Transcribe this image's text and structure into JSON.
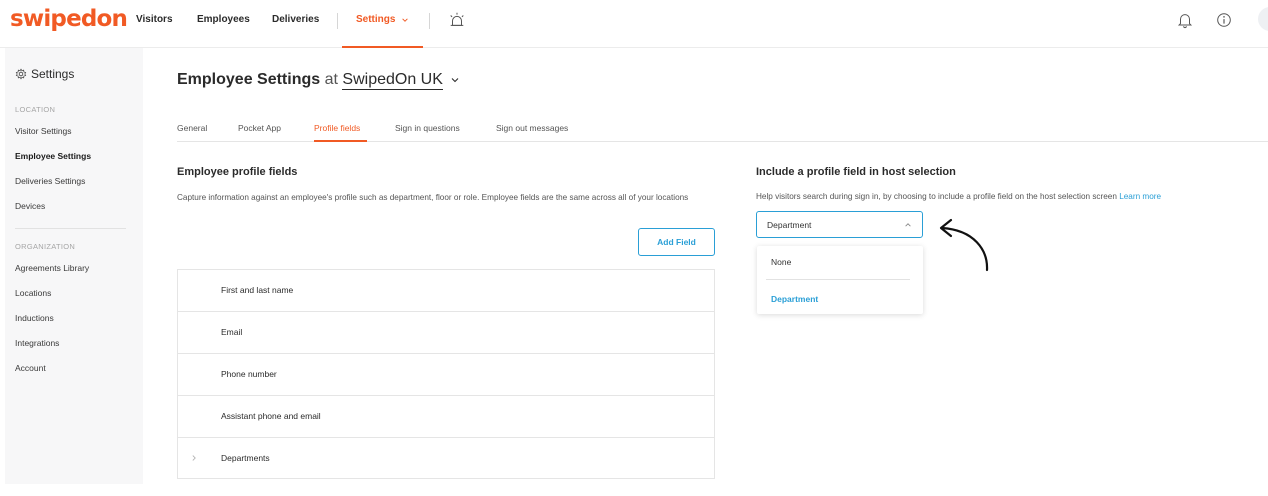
{
  "brand": {
    "logo_text": "swipedon",
    "accent": "#f15a24",
    "link": "#2a9fd6"
  },
  "nav": {
    "visitors": "Visitors",
    "employees": "Employees",
    "deliveries": "Deliveries",
    "settings": "Settings",
    "icons": [
      "emergency-alarm-icon",
      "bell-icon",
      "info-icon",
      "avatar"
    ]
  },
  "sidebar": {
    "title": "Settings",
    "location_section": "LOCATION",
    "location_items": [
      "Visitor Settings",
      "Employee Settings",
      "Deliveries Settings",
      "Devices"
    ],
    "organization_section": "ORGANIZATION",
    "organization_items": [
      "Agreements Library",
      "Locations",
      "Inductions",
      "Integrations",
      "Account"
    ],
    "active_item": "Employee Settings"
  },
  "header": {
    "title": "Employee Settings",
    "at": "at",
    "location": "SwipedOn UK"
  },
  "tabs": [
    "General",
    "Pocket App",
    "Profile fields",
    "Sign in questions",
    "Sign out messages"
  ],
  "active_tab": "Profile fields",
  "profile_fields": {
    "title": "Employee profile fields",
    "description": "Capture information against an employee's profile such as department, floor or role. Employee fields are the same across all of your locations",
    "add_button": "Add Field",
    "rows": [
      "First and last name",
      "Email",
      "Phone number",
      "Assistant phone and email",
      "Departments"
    ]
  },
  "host_selection": {
    "title": "Include a profile field in host selection",
    "description": "Help visitors search during sign in, by choosing to include a profile field on the host selection screen",
    "learn_more": "Learn more",
    "selected": "Department",
    "options": [
      "None",
      "Department"
    ]
  }
}
